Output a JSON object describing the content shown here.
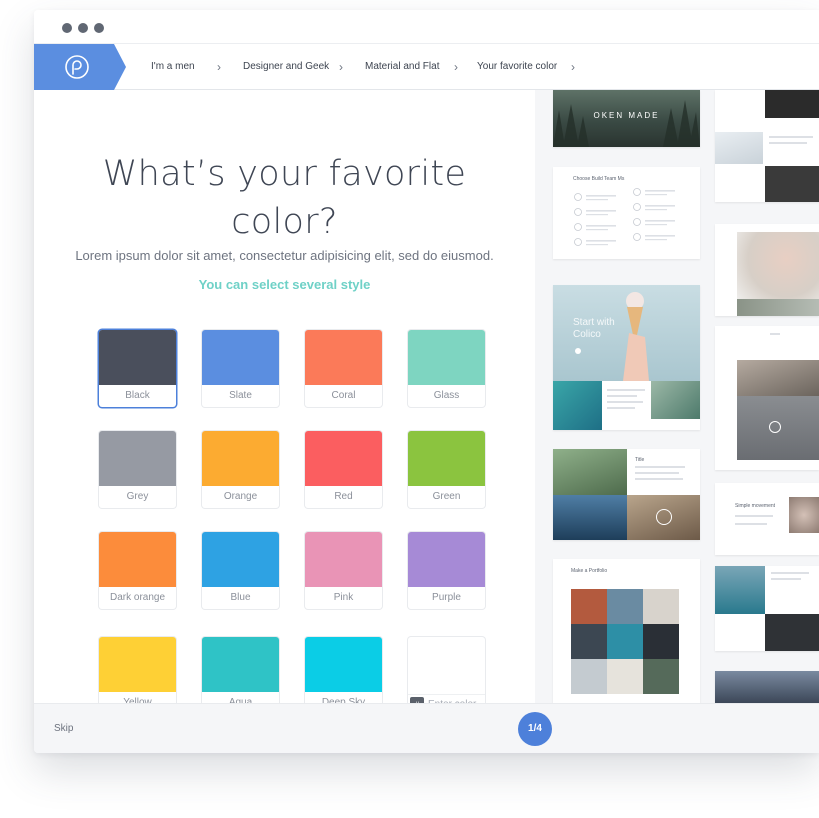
{
  "breadcrumbs": [
    {
      "label": "I'm a men"
    },
    {
      "label": "Designer and Geek"
    },
    {
      "label": "Material and Flat"
    },
    {
      "label": "Your favorite color"
    }
  ],
  "main": {
    "title_line1": "What’s your favorite",
    "title_line2": "color?",
    "subtitle": "Lorem ipsum dolor sit amet, consectetur adipisicing elit, sed do eiusmod.",
    "hint": "You can select several style"
  },
  "colors": [
    {
      "name": "Black",
      "hex": "#4a4f5c",
      "selected": true
    },
    {
      "name": "Slate",
      "hex": "#5b8ee0",
      "selected": false
    },
    {
      "name": "Coral",
      "hex": "#fb7a59",
      "selected": false
    },
    {
      "name": "Glass",
      "hex": "#7ed5c1",
      "selected": false
    },
    {
      "name": "Grey",
      "hex": "#969aa3",
      "selected": false
    },
    {
      "name": "Orange",
      "hex": "#fcab31",
      "selected": false
    },
    {
      "name": "Red",
      "hex": "#fb5e60",
      "selected": false
    },
    {
      "name": "Green",
      "hex": "#8bc43f",
      "selected": false
    },
    {
      "name": "Dark orange",
      "hex": "#fc8c3b",
      "selected": false
    },
    {
      "name": "Blue",
      "hex": "#2ea2e3",
      "selected": false
    },
    {
      "name": "Pink",
      "hex": "#e994b6",
      "selected": false
    },
    {
      "name": "Purple",
      "hex": "#a68ad6",
      "selected": false
    },
    {
      "name": "Yellow",
      "hex": "#fed035",
      "selected": false
    },
    {
      "name": "Aqua",
      "hex": "#2fc3c6",
      "selected": false
    },
    {
      "name": "Deep Sky",
      "hex": "#0bcde6",
      "selected": false
    }
  ],
  "custom_color": {
    "prefix": "#",
    "placeholder": "Enter color"
  },
  "preview_cards": [
    {
      "overlay_text": "OKEN MADE"
    },
    {
      "title": "Choose Build Team Ms"
    },
    {
      "overlay_text": "Start with Colico"
    },
    {
      "title": "Title"
    },
    {
      "title": "Make a Portfolio"
    },
    {
      "title": "Simple movement"
    }
  ],
  "footer": {
    "skip_label": "Skip",
    "step": "1/4"
  },
  "accent": "#4d80da"
}
